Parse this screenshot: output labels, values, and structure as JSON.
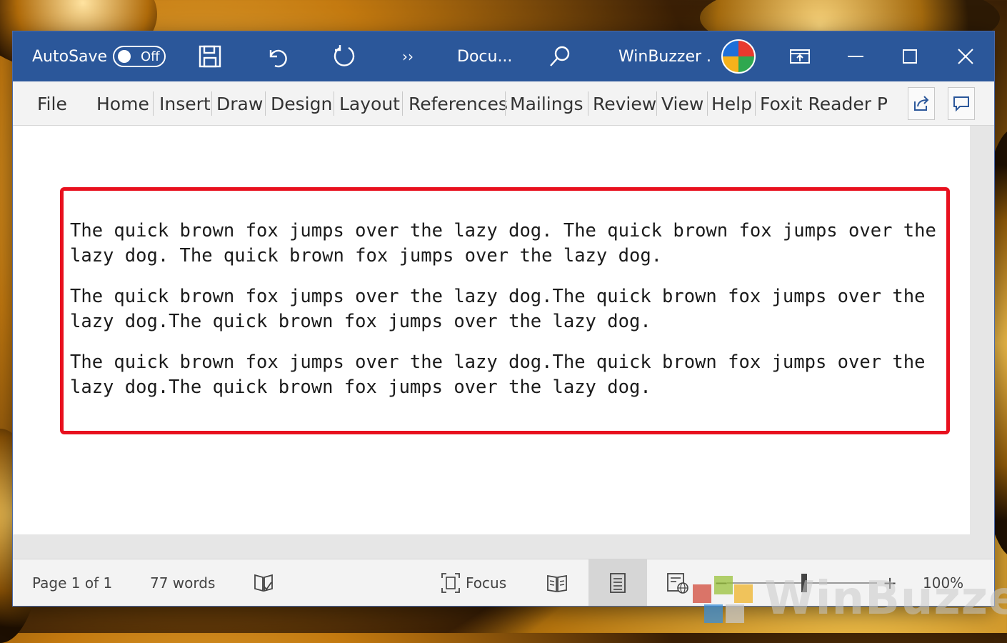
{
  "titlebar": {
    "autosave_label": "AutoSave",
    "autosave_state": "Off",
    "more_label": "››",
    "doc_title": "Docu...",
    "user_name": "WinBuzzer ."
  },
  "ribbon": {
    "tabs": [
      "File",
      "Home",
      "Insert",
      "Draw",
      "Design",
      "Layout",
      "References",
      "Mailings",
      "Review",
      "View",
      "Help",
      "Foxit Reader PI"
    ]
  },
  "document": {
    "paragraphs": [
      "The quick brown fox jumps over the lazy dog. The quick brown fox jumps over the\nlazy dog. The quick brown fox jumps over the lazy dog.",
      "The quick brown fox jumps over the lazy dog.The quick brown fox jumps over the\nlazy dog.The quick brown fox jumps over the lazy dog.",
      "The quick brown fox jumps over the lazy dog.The quick brown fox jumps over the\nlazy dog.The quick brown fox jumps over the lazy dog."
    ],
    "highlight_color": "#e8101e"
  },
  "statusbar": {
    "page_info": "Page 1 of 1",
    "word_count": "77 words",
    "focus_label": "Focus",
    "zoom_minus": "−",
    "zoom_plus": "+",
    "zoom_level": "100%"
  },
  "watermark": {
    "text": "WinBuzzer"
  },
  "colors": {
    "title_bar": "#2b579a",
    "ribbon_bg": "#f3f3f3",
    "page_bg": "#ffffff"
  }
}
